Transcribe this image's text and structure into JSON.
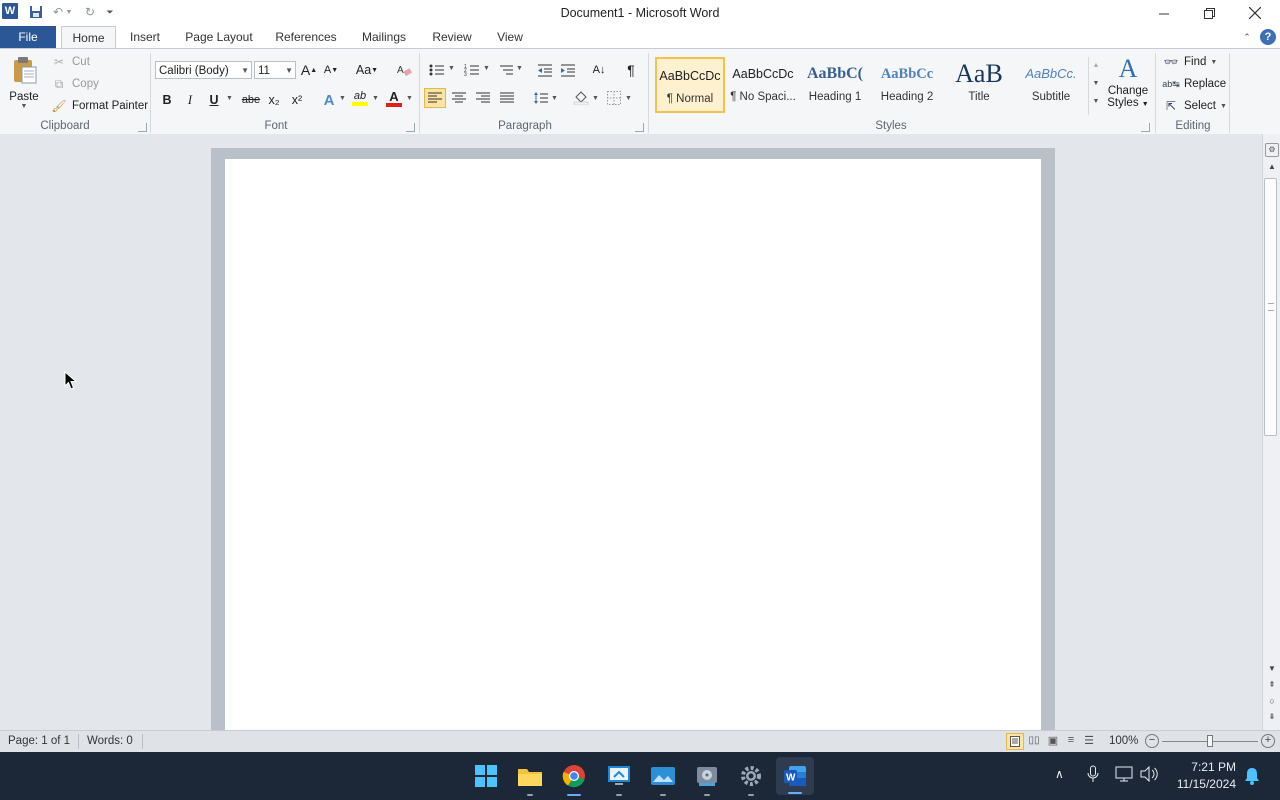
{
  "window": {
    "title": "Document1  -  Microsoft Word",
    "app_icon": "W",
    "quick_access": [
      "save-icon",
      "undo-icon",
      "redo-icon",
      "customize-qat-icon"
    ],
    "controls": [
      "minimize-icon",
      "restore-icon",
      "close-icon"
    ]
  },
  "tabs": [
    {
      "label": "File",
      "active": false
    },
    {
      "label": "Home",
      "active": true
    },
    {
      "label": "Insert",
      "active": false
    },
    {
      "label": "Page Layout",
      "active": false
    },
    {
      "label": "References",
      "active": false
    },
    {
      "label": "Mailings",
      "active": false
    },
    {
      "label": "Review",
      "active": false
    },
    {
      "label": "View",
      "active": false
    }
  ],
  "ribbon": {
    "clipboard": {
      "label": "Clipboard",
      "paste": "Paste",
      "cut": "Cut",
      "copy": "Copy",
      "format_painter": "Format Painter"
    },
    "font": {
      "label": "Font",
      "font_name": "Calibri (Body)",
      "font_size": "11",
      "grow": "A",
      "shrink": "A",
      "change_case": "Aa",
      "bold": "B",
      "italic": "I",
      "underline": "U",
      "strike": "abe",
      "subscript": "x₂",
      "superscript": "x²",
      "text_effects": "A",
      "highlight": "ab",
      "font_color": "A",
      "highlight_color": "#ffff00",
      "font_color_value": "#e0201b"
    },
    "paragraph": {
      "label": "Paragraph",
      "pilcrow": "¶",
      "sort": "A↓"
    },
    "styles": {
      "label": "Styles",
      "items": [
        {
          "sample": "AaBbCcDc",
          "name": "¶ Normal",
          "selected": true
        },
        {
          "sample": "AaBbCcDc",
          "name": "¶ No Spaci...",
          "selected": false
        },
        {
          "sample": "AaBbC(",
          "name": "Heading 1",
          "selected": false
        },
        {
          "sample": "AaBbCc",
          "name": "Heading 2",
          "selected": false
        },
        {
          "sample": "AaB",
          "name": "Title",
          "selected": false
        },
        {
          "sample": "AaBbCc.",
          "name": "Subtitle",
          "selected": false
        }
      ],
      "change_styles_line1": "Change",
      "change_styles_line2": "Styles"
    },
    "editing": {
      "label": "Editing",
      "find": "Find",
      "replace": "Replace",
      "select": "Select"
    }
  },
  "statusbar": {
    "page": "Page: 1 of 1",
    "words": "Words: 0",
    "zoom": "100%",
    "zoom_fraction": 0.5
  },
  "taskbar": {
    "apps": [
      "windows-start-icon",
      "file-explorer-icon",
      "chrome-icon",
      "remote-desktop-icon",
      "photos-icon",
      "disk-icon",
      "settings-icon",
      "word-icon"
    ],
    "time": "7:21 PM",
    "date": "11/15/2024"
  }
}
